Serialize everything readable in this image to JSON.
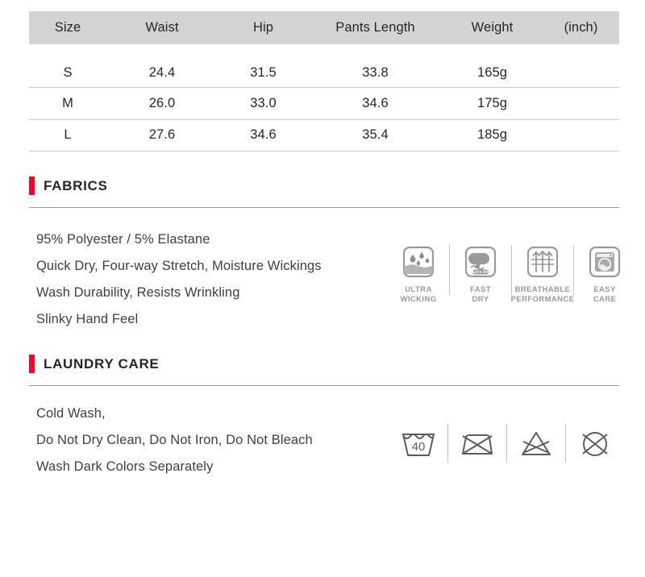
{
  "size_table": {
    "columns": [
      "Size",
      "Waist",
      "Hip",
      "Pants Length",
      "Weight",
      "(inch)"
    ],
    "rows": [
      {
        "size": "S",
        "waist": "24.4",
        "hip": "31.5",
        "length": "33.8",
        "weight": "165g",
        "unit": ""
      },
      {
        "size": "M",
        "waist": "26.0",
        "hip": "33.0",
        "length": "34.6",
        "weight": "175g",
        "unit": ""
      },
      {
        "size": "L",
        "waist": "27.6",
        "hip": "34.6",
        "length": "35.4",
        "weight": "185g",
        "unit": ""
      }
    ]
  },
  "fabrics": {
    "title": "FABRICS",
    "lines": [
      "95% Polyester /  5% Elastane",
      "Quick Dry, Four-way Stretch, Moisture Wickings",
      "Wash Durability, Resists Wrinkling",
      "Slinky Hand Feel"
    ],
    "icons": [
      {
        "icon": "ultra-wicking-icon",
        "line1": "ULTRA",
        "line2": "WICKING"
      },
      {
        "icon": "fast-dry-icon",
        "line1": "FAST",
        "line2": "DRY",
        "badge": "QUICK DRY"
      },
      {
        "icon": "breathable-performance-icon",
        "line1": "BREATHABLE",
        "line2": "PERFORMANCE"
      },
      {
        "icon": "easy-care-icon",
        "line1": "EASY",
        "line2": "CARE"
      }
    ]
  },
  "laundry_care": {
    "title": "LAUNDRY CARE",
    "lines": [
      "Cold Wash,",
      "Do Not Dry Clean, Do Not Iron, Do Not Bleach",
      "Wash Dark Colors Separately"
    ],
    "symbols": [
      {
        "icon": "wash-40-icon",
        "label": "40"
      },
      {
        "icon": "do-not-iron-icon",
        "label": ""
      },
      {
        "icon": "do-not-bleach-icon",
        "label": ""
      },
      {
        "icon": "do-not-dry-clean-icon",
        "label": ""
      }
    ]
  },
  "colors": {
    "accent_red": "#ea0a2a",
    "header_gray": "#d3d3d3",
    "text_dark": "#262626",
    "icon_gray": "#9a9a9a",
    "rule_gray": "#9a9a9a"
  }
}
